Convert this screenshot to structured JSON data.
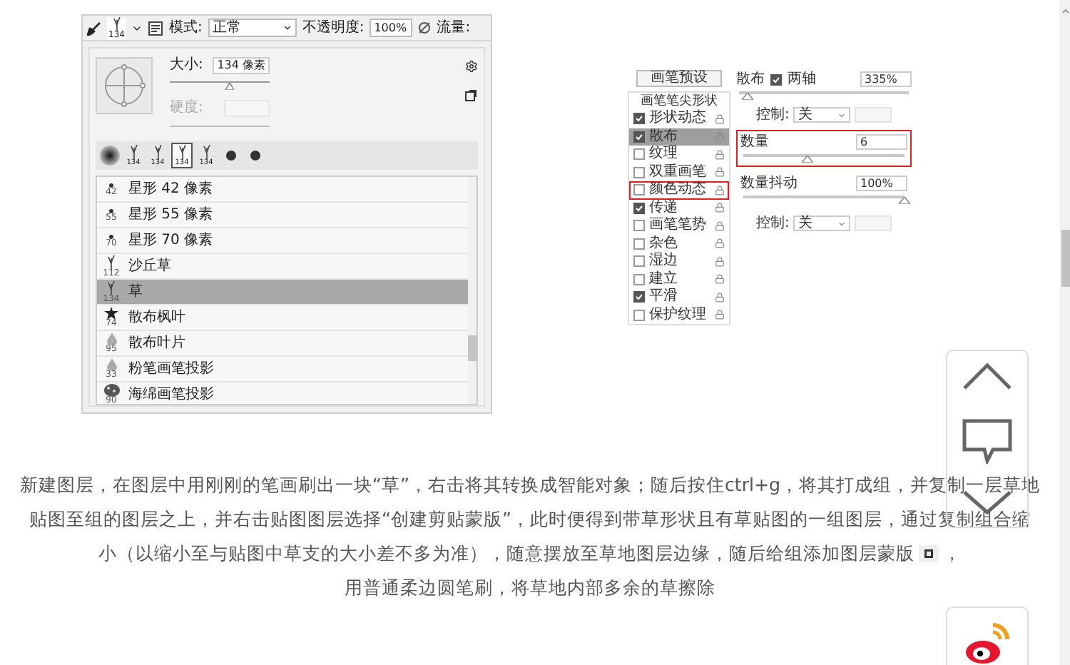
{
  "brush_screenshot": {
    "toolbar": {
      "brush_size": "134",
      "mode_label": "模式:",
      "mode_value": "正常",
      "opacity_label": "不透明度:",
      "opacity_value": "100%",
      "flow_label": "流量:"
    },
    "size": {
      "label": "大小:",
      "value": "134 像素",
      "level": 0.6
    },
    "hardness": {
      "label": "硬度:",
      "disabled": true
    },
    "presets": [
      {
        "kind": "soft",
        "selected": false
      },
      {
        "kind": "grass",
        "size": "134",
        "selected": false
      },
      {
        "kind": "grass",
        "size": "134",
        "selected": false
      },
      {
        "kind": "grass",
        "size": "134",
        "selected": true
      },
      {
        "kind": "grass",
        "size": "134",
        "selected": false
      },
      {
        "kind": "dot",
        "selected": false
      },
      {
        "kind": "dot",
        "selected": false
      }
    ],
    "brushes": [
      {
        "kind": "star",
        "name": "星形 42 像素",
        "size": "42",
        "selected": false
      },
      {
        "kind": "star",
        "name": "星形 55 像素",
        "size": "55",
        "selected": false
      },
      {
        "kind": "star",
        "name": "星形 70 像素",
        "size": "70",
        "selected": false
      },
      {
        "kind": "grass",
        "name": "沙丘草",
        "size": "112",
        "selected": false
      },
      {
        "kind": "grass",
        "name": "草",
        "size": "134",
        "selected": true
      },
      {
        "kind": "maple",
        "name": "散布枫叶",
        "size": "74",
        "selected": false
      },
      {
        "kind": "drop",
        "name": "散布叶片",
        "size": "95",
        "selected": false
      },
      {
        "kind": "drop",
        "name": "粉笔画笔投影",
        "size": "33",
        "selected": false
      },
      {
        "kind": "sponge",
        "name": "海绵画笔投影",
        "size": "90",
        "selected": false
      }
    ]
  },
  "dynamics_screenshot": {
    "preset_button": "画笔预设",
    "tip_shape": "画笔笔尖形状",
    "options": [
      {
        "label": "形状动态",
        "checked": true,
        "selected": false,
        "marked": false
      },
      {
        "label": "散布",
        "checked": true,
        "selected": true,
        "marked": false
      },
      {
        "label": "纹理",
        "checked": false,
        "selected": false,
        "marked": false
      },
      {
        "label": "双重画笔",
        "checked": false,
        "selected": false,
        "marked": false
      },
      {
        "label": "颜色动态",
        "checked": false,
        "selected": false,
        "marked": true
      },
      {
        "label": "传递",
        "checked": true,
        "selected": false,
        "marked": false
      },
      {
        "label": "画笔笔势",
        "checked": false,
        "selected": false,
        "marked": false
      },
      {
        "label": "杂色",
        "checked": false,
        "selected": false,
        "marked": false
      },
      {
        "label": "湿边",
        "checked": false,
        "selected": false,
        "marked": false
      },
      {
        "label": "建立",
        "checked": false,
        "selected": false,
        "marked": false
      },
      {
        "label": "平滑",
        "checked": true,
        "selected": false,
        "marked": false
      },
      {
        "label": "保护纹理",
        "checked": false,
        "selected": false,
        "marked": false
      }
    ],
    "settings": [
      {
        "kind": "scatter",
        "label": "散布",
        "axes_label": "两轴",
        "axes_checked": true,
        "value": "335%",
        "level": 0.05
      },
      {
        "kind": "control",
        "label": "控制:",
        "value": "关"
      },
      {
        "kind": "slider",
        "label": "数量",
        "value": "6",
        "level": 0.4,
        "marked": true
      },
      {
        "kind": "slider",
        "label": "数量抖动",
        "value": "100%",
        "level": 1,
        "marked": false
      },
      {
        "kind": "control",
        "label": "控制:",
        "value": "关"
      }
    ]
  },
  "paragraph": {
    "lines": [
      "新建图层，在图层中用刚刚的笔画刷出一块“草”，右击将其转换成智能对象；随后按住ctrl+g，将其打成组，并复制一层草地",
      "贴图至组的图层之上，并右击贴图图层选择“创建剪贴蒙版”，此时便得到带草形状且有草贴图的一组图层，通过复制组合缩",
      "小（以缩小至与贴图中草支的大小差不多为准），随意摆放至草地图层边缘，随后给组添加图层蒙版"
    ],
    "after_icon": "，"
  },
  "paragraph_2": "用普通柔边圆笔刷，将草地内部多余的草擦除"
}
